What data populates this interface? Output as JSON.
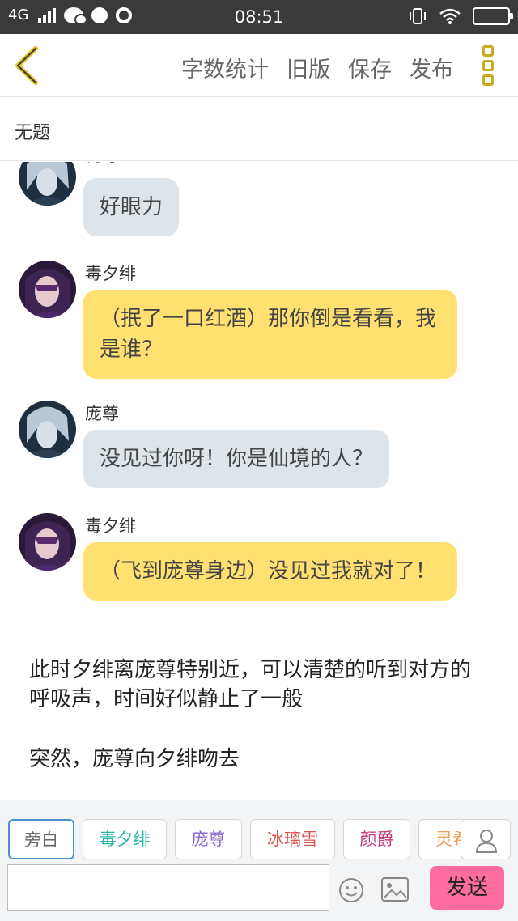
{
  "status_bar": {
    "network": "4G",
    "time": "08:51"
  },
  "toolbar": {
    "actions": [
      "字数统计",
      "旧版",
      "保存",
      "发布"
    ]
  },
  "document": {
    "title": "无题"
  },
  "messages": [
    {
      "speaker": "庞尊",
      "text": "好眼力",
      "bubble_color": "#dde5ea"
    },
    {
      "speaker": "毒夕绯",
      "text": "（抿了一口红酒）那你倒是看看，我是谁？",
      "bubble_color": "#ffe070"
    },
    {
      "speaker": "庞尊",
      "text": "没见过你呀！你是仙境的人？",
      "bubble_color": "#dde5ea"
    },
    {
      "speaker": "毒夕绯",
      "text": "（飞到庞尊身边）没见过我就对了！",
      "bubble_color": "#ffe070"
    }
  ],
  "narration": [
    "此时夕绯离庞尊特别近，可以清楚的听到对方的呼吸声，时间好似静止了一般",
    "突然，庞尊向夕绯吻去"
  ],
  "characters": [
    {
      "label": "旁白",
      "color": "#666666",
      "active": true
    },
    {
      "label": "毒夕绯",
      "color": "#2bb5a6",
      "active": false
    },
    {
      "label": "庞尊",
      "color": "#8a6bd1",
      "active": false
    },
    {
      "label": "冰璃雪",
      "color": "#d9534f",
      "active": false
    },
    {
      "label": "颜爵",
      "color": "#c0397a",
      "active": false
    },
    {
      "label": "灵希",
      "color": "#e8a15a",
      "active": false
    }
  ],
  "composer": {
    "placeholder": "",
    "send_label": "发送"
  },
  "colors": {
    "accent_yellow": "#ffe070",
    "send_pink": "#ff6da0"
  }
}
